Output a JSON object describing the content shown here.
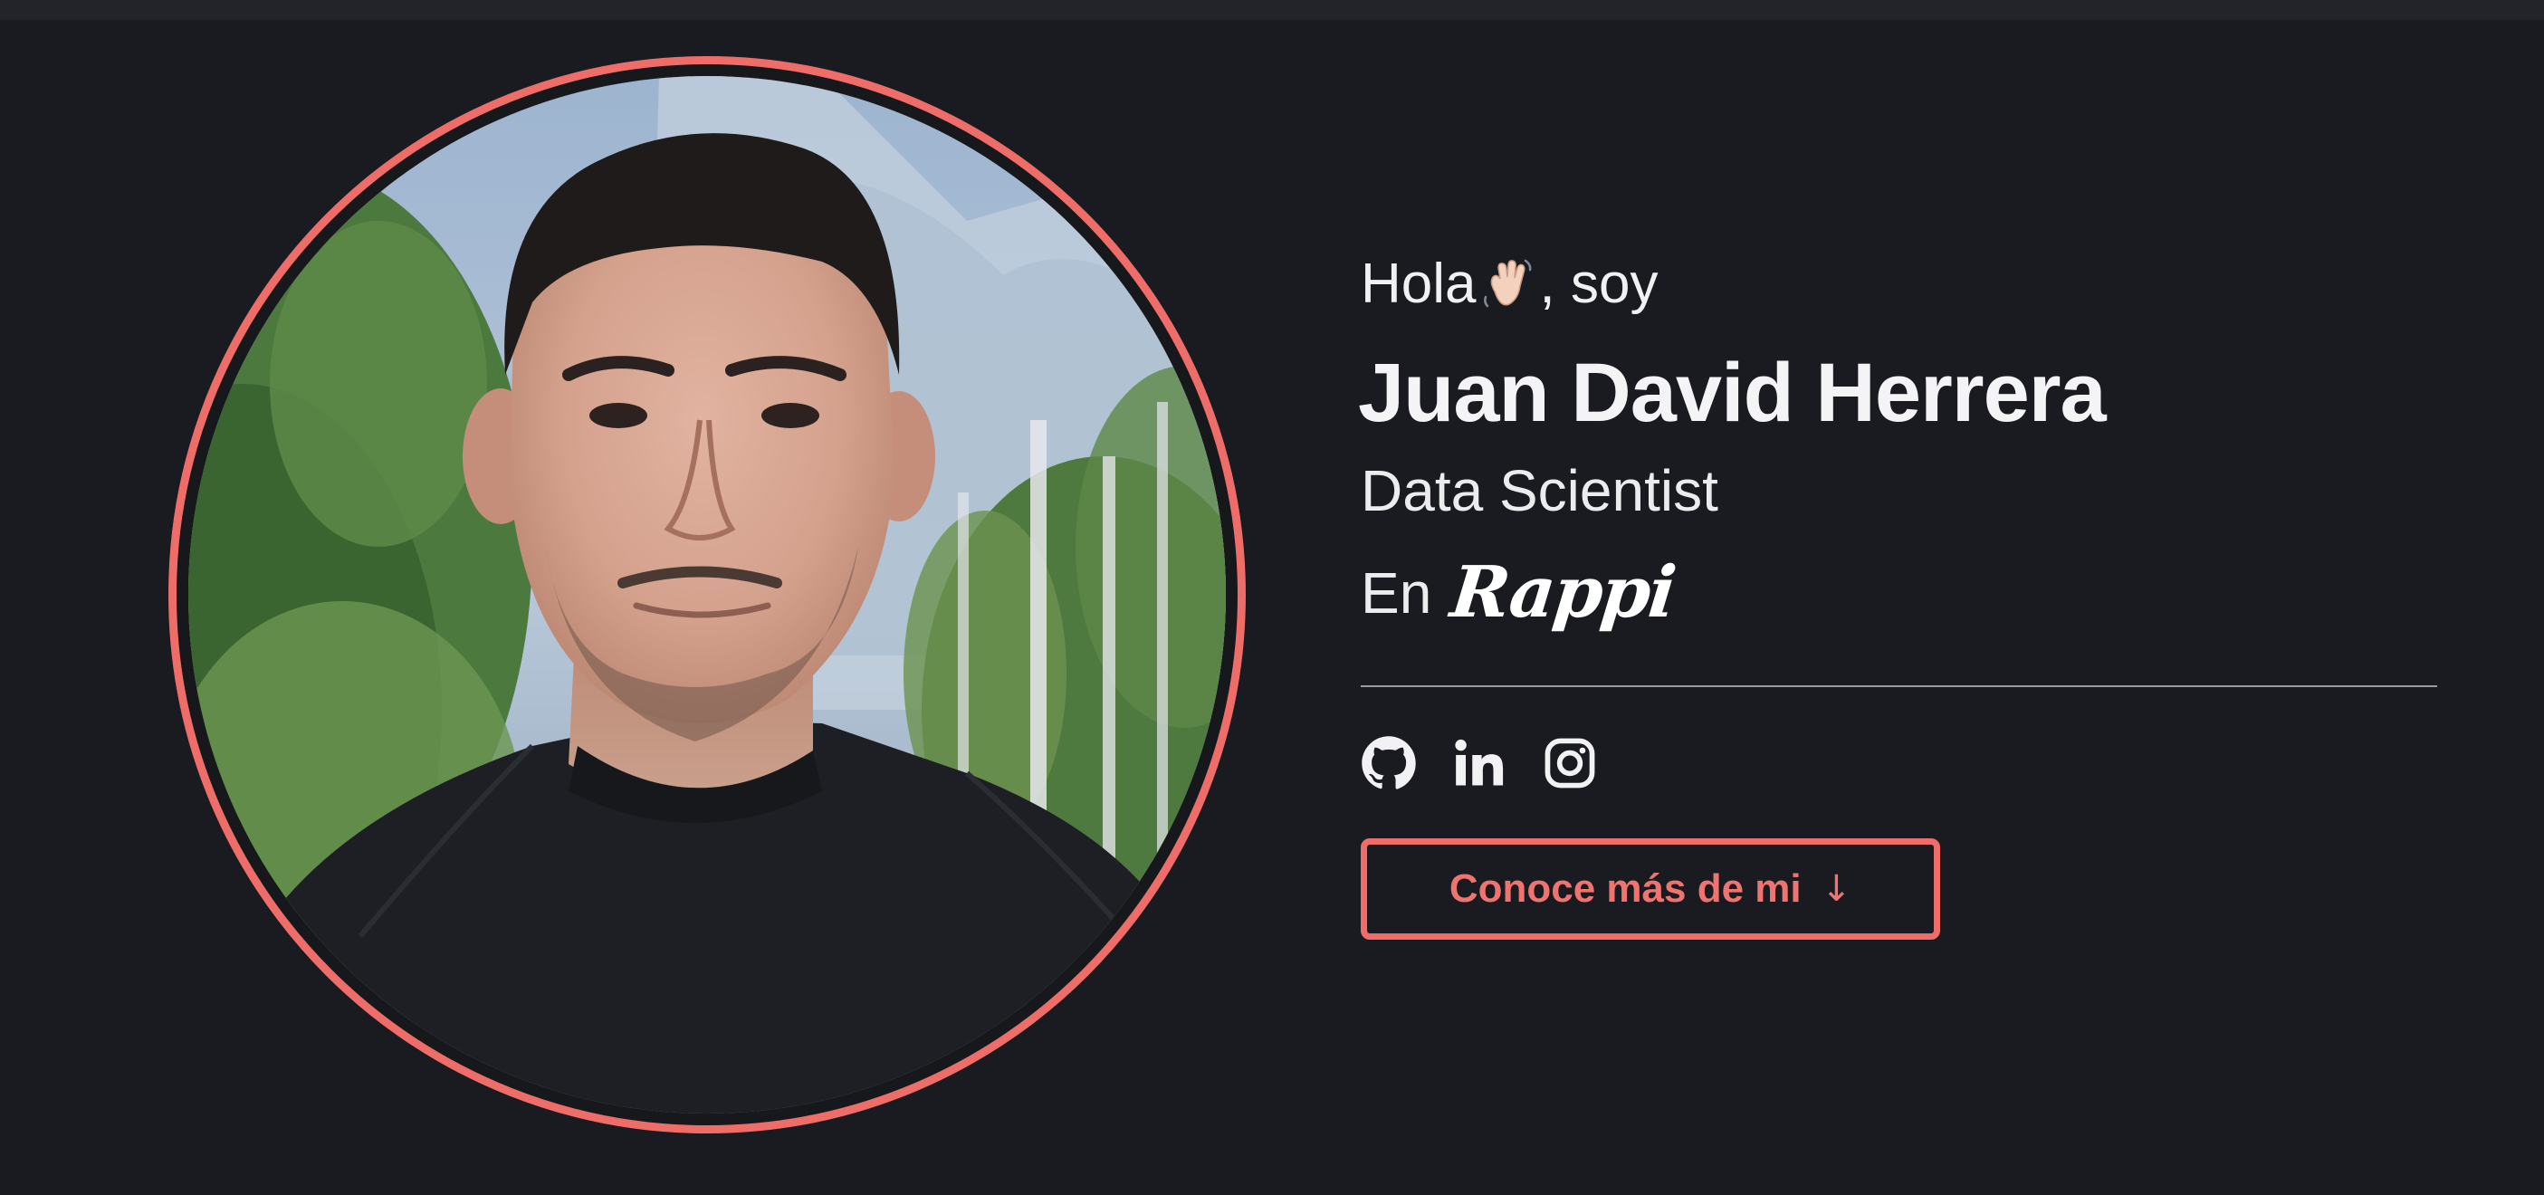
{
  "hero": {
    "greeting_prefix": "Hola",
    "greeting_emoji": "waving-hand-icon",
    "greeting_suffix": ", soy",
    "name": "Juan David Herrera",
    "role": "Data Scientist",
    "company_prefix": "En",
    "company_logo_text": "Rappi",
    "accent_color": "#ee6d68",
    "background_color": "#191b21"
  },
  "socials": [
    {
      "icon": "github-icon"
    },
    {
      "icon": "linkedin-icon"
    },
    {
      "icon": "instagram-icon"
    }
  ],
  "cta": {
    "label": "Conoce más de mi",
    "arrow": "↓"
  }
}
